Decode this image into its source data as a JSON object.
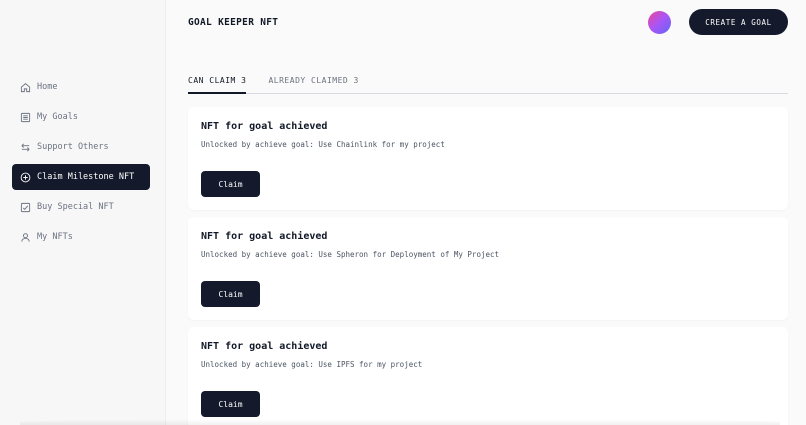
{
  "header": {
    "brand": "GOAL KEEPER NFT",
    "create_label": "CREATE A GOAL"
  },
  "sidebar": {
    "items": [
      {
        "label": "Home",
        "icon": "home-icon"
      },
      {
        "label": "My Goals",
        "icon": "list-icon"
      },
      {
        "label": "Support Others",
        "icon": "arrows-exchange-icon"
      },
      {
        "label": "Claim Milestone NFT",
        "icon": "plus-circle-icon",
        "active": true
      },
      {
        "label": "Buy Special NFT",
        "icon": "cart-icon"
      },
      {
        "label": "My NFTs",
        "icon": "user-icon"
      }
    ]
  },
  "tabs": [
    {
      "label": "CAN CLAIM 3",
      "active": true
    },
    {
      "label": "ALREADY CLAIMED 3",
      "active": false
    }
  ],
  "cards": [
    {
      "title": "NFT for goal achieved",
      "desc": "Unlocked by achieve goal: Use Chainlink for my project",
      "button": "Claim"
    },
    {
      "title": "NFT for goal achieved",
      "desc": "Unlocked by achieve goal: Use Spheron for Deployment of My Project",
      "button": "Claim"
    },
    {
      "title": "NFT for goal achieved",
      "desc": "Unlocked by achieve goal: Use IPFS for my project",
      "button": "Claim"
    }
  ],
  "colors": {
    "primary": "#141a2b",
    "background": "#fafafa",
    "sidebar": "#f7f7f8"
  }
}
